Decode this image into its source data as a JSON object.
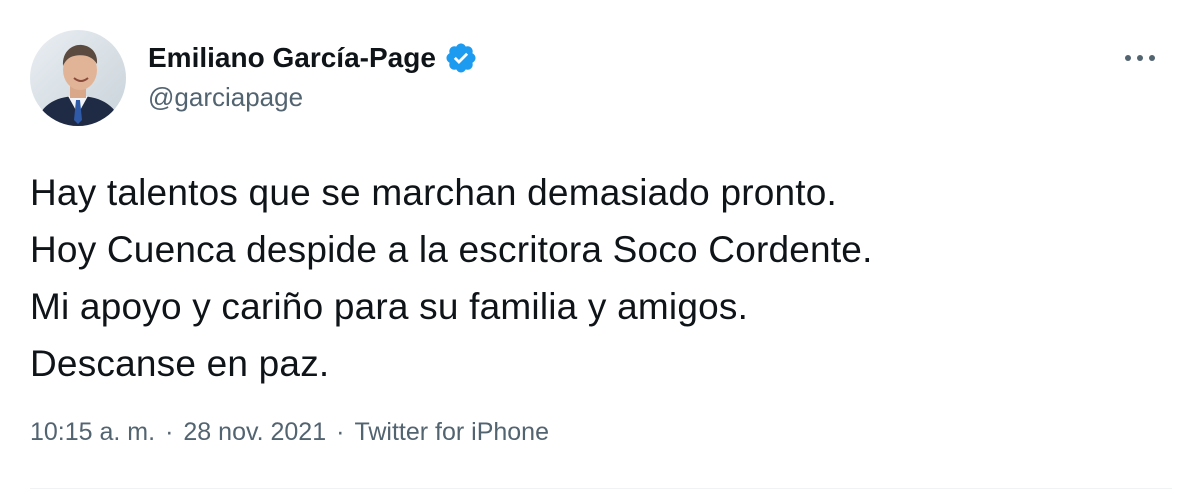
{
  "author": {
    "display_name": "Emiliano García-Page",
    "handle": "@garciapage",
    "verified": true
  },
  "tweet": {
    "lines": [
      "Hay talentos que se marchan demasiado pronto.",
      "Hoy Cuenca despide a la escritora Soco Cordente.",
      "Mi apoyo y cariño para su familia y amigos.",
      "Descanse en paz."
    ]
  },
  "meta": {
    "time": "10:15 a. m.",
    "separator": "·",
    "date": "28 nov. 2021",
    "source": "Twitter for iPhone"
  },
  "colors": {
    "text": "#0f1419",
    "secondary": "#536471",
    "verified_blue": "#1d9bf0"
  },
  "icons": {
    "verified": "verified-badge-icon",
    "more": "more-options-icon"
  }
}
